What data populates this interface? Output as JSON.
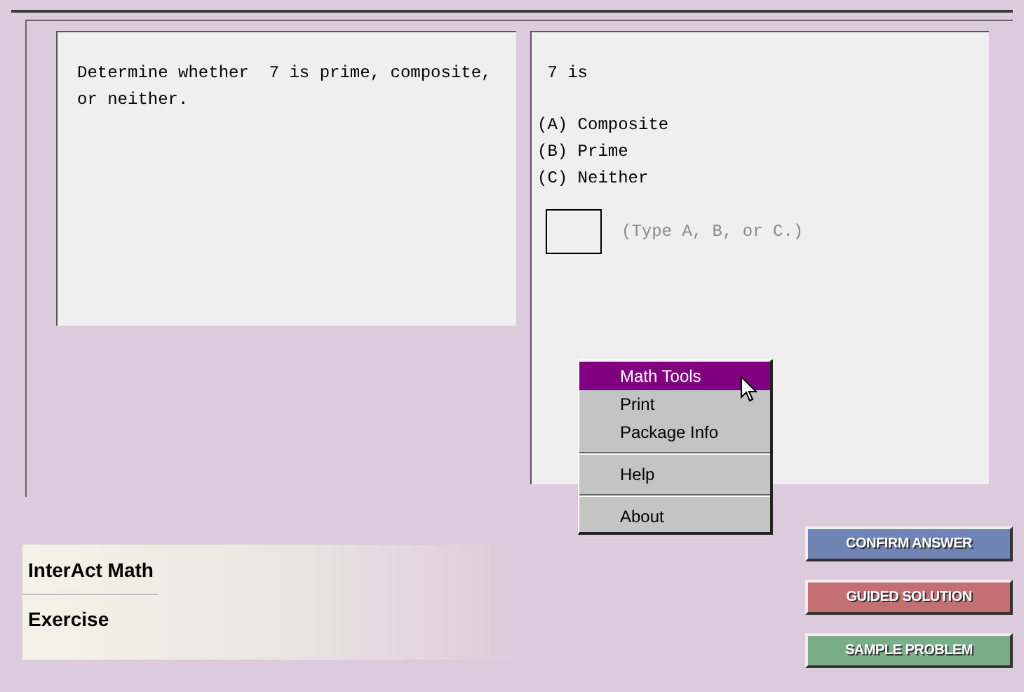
{
  "problem": {
    "text": "Determine whether  7 is prime, composite, or neither."
  },
  "answer": {
    "stem": " 7 is",
    "choices": [
      "(A) Composite",
      "(B) Prime",
      "(C) Neither"
    ],
    "field": {
      "placeholder": "(Type A, B, or C.)"
    }
  },
  "context_menu": [
    {
      "kind": "item",
      "label": "Math Tools",
      "selected": true
    },
    {
      "kind": "item",
      "label": "Print",
      "selected": false
    },
    {
      "kind": "item",
      "label": "Package Info",
      "selected": false
    },
    {
      "kind": "separator"
    },
    {
      "kind": "item",
      "label": "Help",
      "selected": false
    },
    {
      "kind": "separator"
    },
    {
      "kind": "item",
      "label": "About",
      "selected": false
    }
  ],
  "info": {
    "product": "InterAct Math",
    "mode": "Exercise"
  },
  "buttons": [
    {
      "label": "CONFIRM ANSWER",
      "color": "#6f84b4"
    },
    {
      "label": "GUIDED SOLUTION",
      "color": "#c46f72"
    },
    {
      "label": "SAMPLE PROBLEM",
      "color": "#79ae88"
    }
  ]
}
